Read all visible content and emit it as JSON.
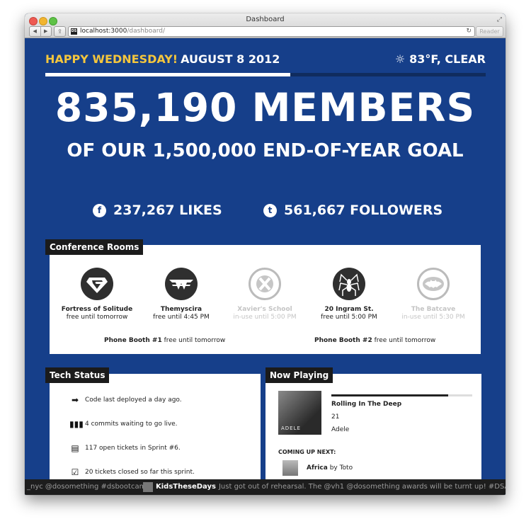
{
  "window": {
    "title": "Dashboard"
  },
  "browser": {
    "url_host": "localhost:3000",
    "url_path": "/dashboard/",
    "reader_label": "Reader",
    "favicon_text": "DS"
  },
  "header": {
    "greeting": "HAPPY WEDNESDAY!",
    "date": "AUGUST 8 2012",
    "weather": "83°F, CLEAR",
    "goal_progress_fraction": 0.557
  },
  "members": {
    "headline": "835,190 MEMBERS",
    "subline": "OF OUR 1,500,000 END-OF-YEAR GOAL"
  },
  "social": {
    "facebook": "237,267 LIKES",
    "twitter": "561,667 FOLLOWERS"
  },
  "conference_rooms": {
    "label": "Conference Rooms",
    "rooms": [
      {
        "name": "Fortress of Solitude",
        "status": "free until tomorrow",
        "free": true,
        "emblem": "superman-icon"
      },
      {
        "name": "Themyscira",
        "status": "free until 4:45 PM",
        "free": true,
        "emblem": "wonder-woman-icon"
      },
      {
        "name": "Xavier's School",
        "status": "in-use until 5:00 PM",
        "free": false,
        "emblem": "x-men-icon"
      },
      {
        "name": "20 Ingram St.",
        "status": "free until 5:00 PM",
        "free": true,
        "emblem": "spider-icon"
      },
      {
        "name": "The Batcave",
        "status": "in-use until 5:30 PM",
        "free": false,
        "emblem": "bat-icon"
      }
    ],
    "booths": [
      {
        "name": "Phone Booth #1",
        "status": "free until tomorrow"
      },
      {
        "name": "Phone Booth #2",
        "status": "free until tomorrow"
      }
    ]
  },
  "tech_status": {
    "label": "Tech Status",
    "items": [
      {
        "icon": "deploy-icon",
        "text": "Code last deployed a day ago."
      },
      {
        "icon": "commits-icon",
        "text": "4 commits waiting to go live."
      },
      {
        "icon": "tickets-icon",
        "text": "117 open tickets in Sprint #6."
      },
      {
        "icon": "check-icon",
        "text": "20 tickets closed so far this sprint."
      }
    ]
  },
  "now_playing": {
    "label": "Now Playing",
    "title": "Rolling In The Deep",
    "album": "21",
    "artist": "Adele",
    "cover_text": "ADELE",
    "progress_fraction": 0.83,
    "up_next_label": "COMING UP NEXT:",
    "next_title": "Africa",
    "next_by": "by Toto"
  },
  "ticker": {
    "tweet1": "_nyc @dosomething #dsbootcamp",
    "tweet2_handle": "KidsTheseDays",
    "tweet2_text": "Just got out of rehearsal. The @vh1 @dosomething awards will be turnt up! #DSAwards #represent"
  }
}
